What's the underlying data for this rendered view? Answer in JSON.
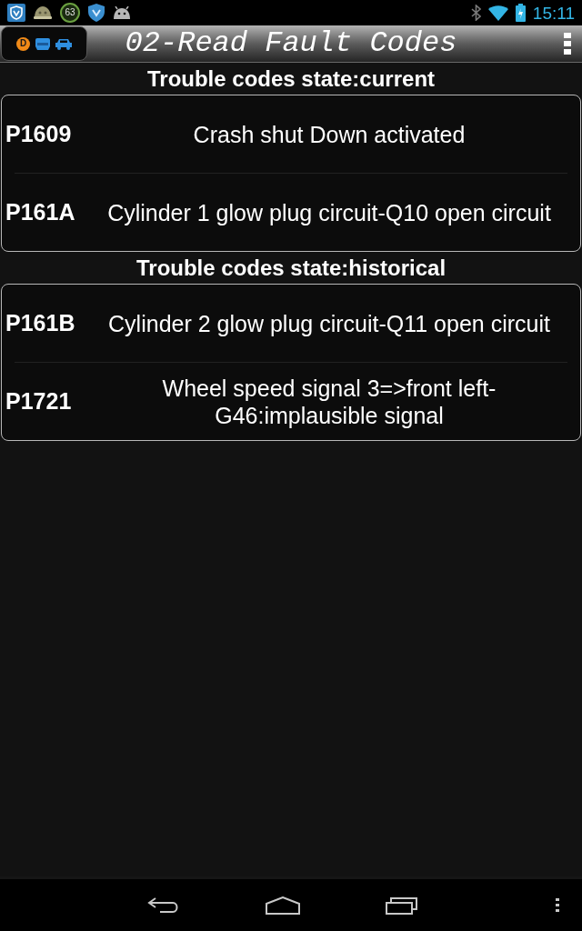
{
  "status_bar": {
    "counter": "63",
    "time": "15:11"
  },
  "app_bar": {
    "mode_letter": "D",
    "title": "02-Read Fault Codes"
  },
  "sections": [
    {
      "heading": "Trouble codes state:current",
      "faults": [
        {
          "code": "P1609",
          "description": "Crash shut Down activated"
        },
        {
          "code": "P161A",
          "description": "Cylinder 1 glow plug circuit-Q10 open circuit"
        }
      ]
    },
    {
      "heading": "Trouble codes state:historical",
      "faults": [
        {
          "code": "P161B",
          "description": "Cylinder 2 glow plug circuit-Q11 open circuit"
        },
        {
          "code": "P1721",
          "description": "Wheel speed signal 3=>front left-G46:implausible signal"
        }
      ]
    }
  ]
}
